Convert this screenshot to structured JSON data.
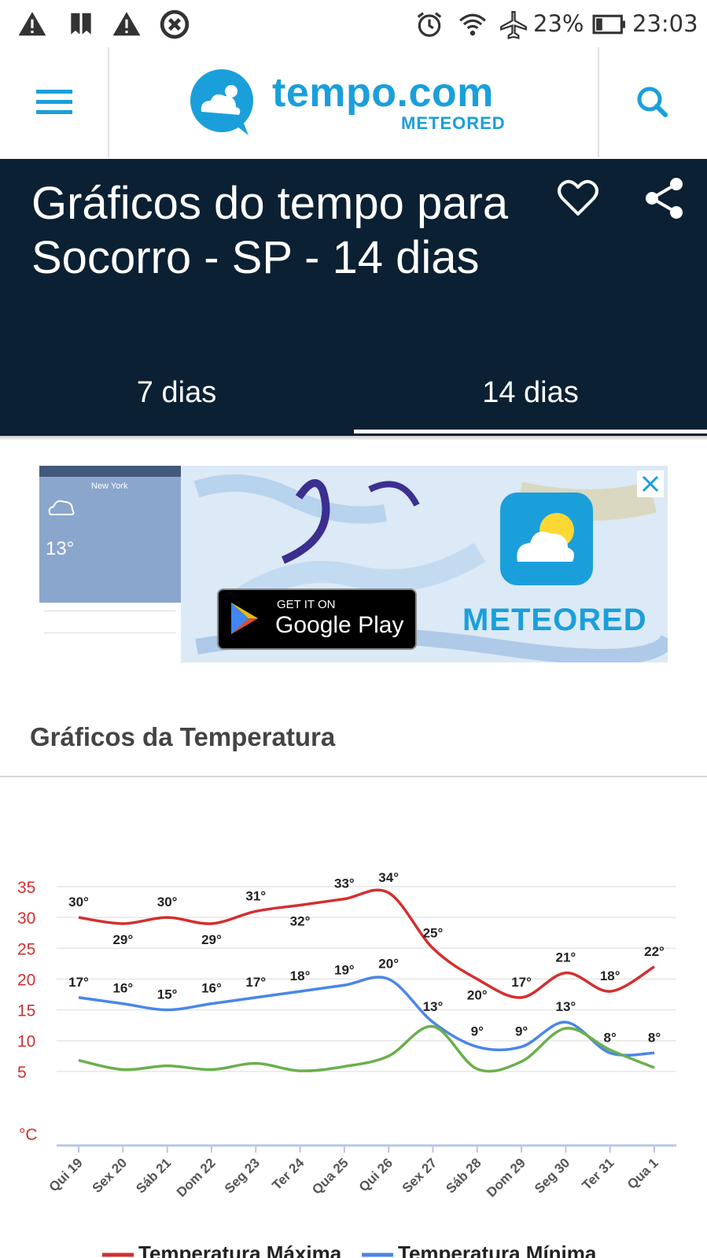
{
  "status_bar": {
    "battery_percent": "23%",
    "time": "23:03",
    "icons": [
      "warning-icon",
      "bookmark-icon",
      "warning-icon",
      "blocked-icon",
      "alarm-icon",
      "wifi-icon",
      "airplane-icon",
      "battery-icon"
    ]
  },
  "header": {
    "logo_word": "tempo.com",
    "logo_sub": "METEORED",
    "brand_color": "#1a9fdb"
  },
  "title_block": {
    "title": "Gráficos do tempo para Socorro - SP - 14 dias",
    "tabs": [
      {
        "label": "7 dias",
        "active": false
      },
      {
        "label": "14 dias",
        "active": true
      }
    ],
    "background": "#0c2033"
  },
  "ad": {
    "google_play_small": "GET IT ON",
    "google_play_big": "Google Play",
    "brand": "METEORED",
    "phone_city": "New York",
    "phone_temp": "13°"
  },
  "section": {
    "title": "Gráficos da Temperatura"
  },
  "chart_data": {
    "type": "line",
    "categories": [
      "Qui 19",
      "Sex 20",
      "Sáb 21",
      "Dom 22",
      "Seg 23",
      "Ter 24",
      "Qua 25",
      "Qui 26",
      "Sex 27",
      "Sáb 28",
      "Dom 29",
      "Seg 30",
      "Ter 31",
      "Qua 1"
    ],
    "series": [
      {
        "name": "Temperatura Máxima",
        "color": "#d32f2f",
        "values": [
          30,
          29,
          30,
          29,
          31,
          32,
          33,
          34,
          25,
          20,
          17,
          21,
          18,
          22
        ],
        "labels": [
          "30°",
          "29°",
          "30°",
          "29°",
          "31°",
          "32°",
          "33°",
          "34°",
          "25°",
          "20°",
          "17°",
          "21°",
          "18°",
          "22°"
        ]
      },
      {
        "name": "Temperatura Mínima",
        "color": "#4a86e8",
        "values": [
          17,
          16,
          15,
          16,
          17,
          18,
          19,
          20,
          13,
          9,
          9,
          13,
          8,
          8
        ],
        "labels": [
          "17°",
          "16°",
          "15°",
          "16°",
          "17°",
          "18°",
          "19°",
          "20°",
          "13°",
          "9°",
          "9°",
          "13°",
          "8°",
          "8°"
        ]
      },
      {
        "color": "#6ab04c",
        "values": [
          6.8,
          5.3,
          5.9,
          5.3,
          6.3,
          5.1,
          5.8,
          7.5,
          12.3,
          5.4,
          6.6,
          12.0,
          8.5,
          5.6
        ]
      }
    ],
    "yticks": [
      "35",
      "30",
      "25",
      "20",
      "15",
      "10",
      "5"
    ],
    "ylim": [
      0,
      35
    ],
    "yunit": "°C",
    "grid": true,
    "legend_position": "bottom"
  }
}
